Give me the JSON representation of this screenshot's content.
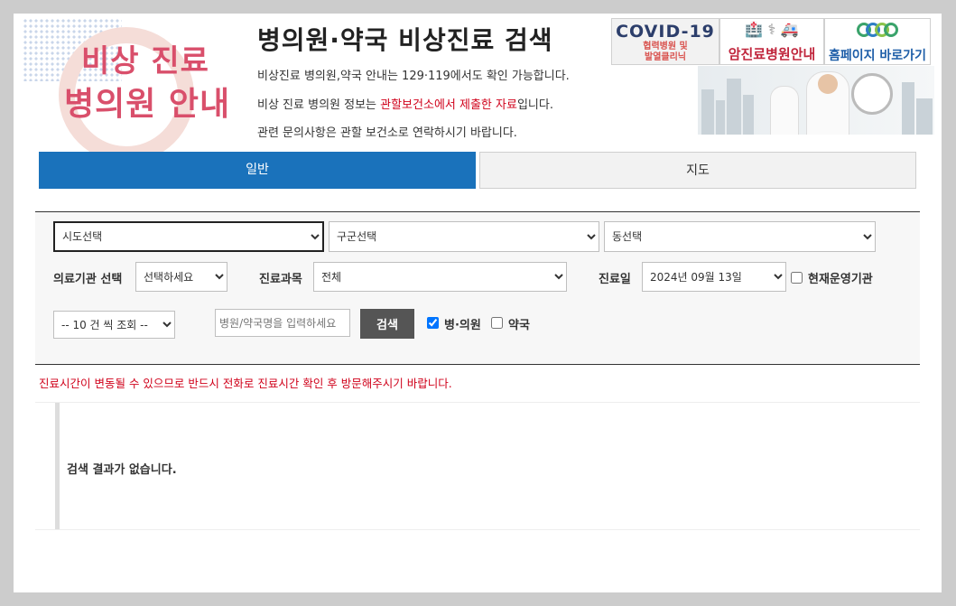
{
  "logo": {
    "line1": "비상 진료",
    "line2": "병의원 안내"
  },
  "header": {
    "title": "병의원·약국 비상진료 검색",
    "info1": "비상진료 병의원,약국 안내는 129·119에서도 확인 가능합니다.",
    "info2_prefix": "비상 진료 병의원 정보는 ",
    "info2_highlight": "관할보건소에서 제출한 자료",
    "info2_suffix": "입니다.",
    "info3": "관련 문의사항은 관할 보건소로 연락하시기 바랍니다."
  },
  "banners": {
    "covid": {
      "title": "COVID-19",
      "line1": "협력병원 및",
      "line2": "발열클리닉"
    },
    "cancer": {
      "label": "암진료병원안내"
    },
    "homepage": {
      "label": "홈페이지 바로가기"
    }
  },
  "tabs": {
    "general": "일반",
    "map": "지도"
  },
  "search": {
    "sido": "시도선택",
    "gugun": "구군선택",
    "dong": "동선택",
    "institution_label": "의료기관 선택",
    "institution_value": "선택하세요",
    "dept_label": "진료과목",
    "dept_value": "전체",
    "date_label": "진료일",
    "date_value": "2024년 09월 13일",
    "open_now_label": "현재운영기관",
    "open_now_checked": false,
    "page_size": "-- 10 건 씩 조회 --",
    "name_placeholder": "병원/약국명을 입력하세요",
    "search_button": "검색",
    "hospital_label": "병·의원",
    "hospital_checked": true,
    "pharmacy_label": "약국",
    "pharmacy_checked": false
  },
  "notice": "진료시간이 변동될 수 있으므로 반드시 전화로 진료시간 확인 후 방문해주시기 바랍니다.",
  "results": {
    "empty_message": "검색 결과가 없습니다."
  },
  "colors": {
    "tab_active": "#1a72bb",
    "logo": "#d94f6b",
    "notice": "#d0021b"
  }
}
